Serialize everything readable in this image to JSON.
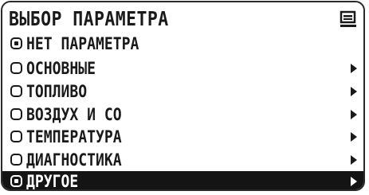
{
  "title": "ВЫБОР ПАРАМЕТРА",
  "menu_icon": "menu-list-icon",
  "items": [
    {
      "label": "НЕТ ПАРАМЕТРА",
      "checked": true,
      "has_submenu": false,
      "selected": false
    },
    {
      "label": "ОСНОВНЫЕ",
      "checked": false,
      "has_submenu": true,
      "selected": false
    },
    {
      "label": "ТОПЛИВО",
      "checked": false,
      "has_submenu": true,
      "selected": false
    },
    {
      "label": "ВОЗДУХ И СО",
      "checked": false,
      "has_submenu": true,
      "selected": false
    },
    {
      "label": "ТЕМПЕРАТУРА",
      "checked": false,
      "has_submenu": true,
      "selected": false
    },
    {
      "label": "ДИАГНОСТИКА",
      "checked": false,
      "has_submenu": true,
      "selected": false
    },
    {
      "label": "ДРУГОЕ",
      "checked": true,
      "has_submenu": true,
      "selected": true
    }
  ],
  "colors": {
    "foreground": "#1a1a1a",
    "highlight_bg": "#141414",
    "highlight_fg": "#ffffff",
    "background": "#ffffff"
  }
}
